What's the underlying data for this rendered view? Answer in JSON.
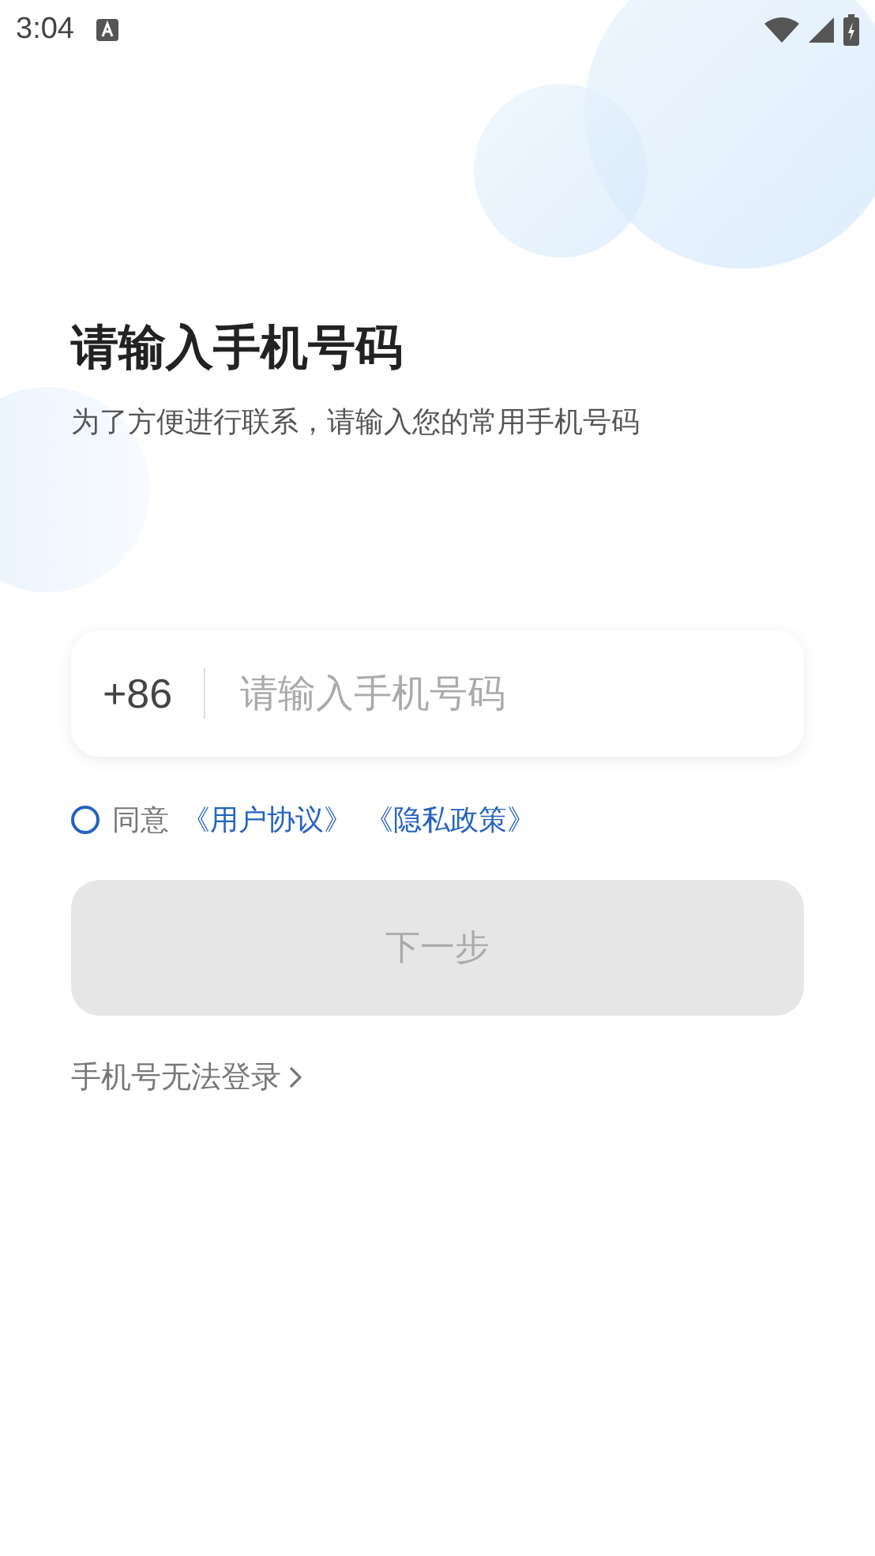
{
  "status_bar": {
    "time": "3:04"
  },
  "title": "请输入手机号码",
  "subtitle": "为了方便进行联系，请输入您的常用手机号码",
  "phone_field": {
    "country_code": "+86",
    "placeholder": "请输入手机号码"
  },
  "agreement": {
    "checked": false,
    "prefix": "同意",
    "links": [
      "《用户协议》",
      "《隐私政策》"
    ]
  },
  "next_button": {
    "label": "下一步",
    "disabled": true
  },
  "help_link": "手机号无法登录"
}
